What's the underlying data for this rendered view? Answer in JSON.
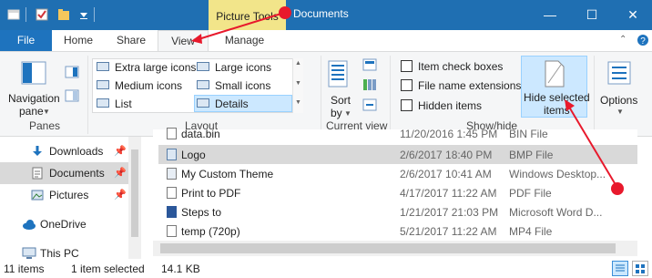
{
  "titlebar": {
    "contextual_tab": "Picture Tools",
    "window_title": "Documents",
    "minimize": "—",
    "maximize": "☐",
    "close": "✕"
  },
  "tabs": {
    "file": "File",
    "home": "Home",
    "share": "Share",
    "view": "View",
    "manage": "Manage"
  },
  "ribbon": {
    "panes": {
      "navigation_pane_line1": "Navigation",
      "navigation_pane_line2": "pane",
      "group": "Panes"
    },
    "layout": {
      "items": [
        "Extra large icons",
        "Large icons",
        "Medium icons",
        "Small icons",
        "List",
        "Details"
      ],
      "selected": "Details",
      "group": "Layout"
    },
    "current_view": {
      "sort_line1": "Sort",
      "sort_line2": "by",
      "group": "Current view"
    },
    "show_hide": {
      "item_check_boxes": "Item check boxes",
      "file_name_extensions": "File name extensions",
      "hidden_items": "Hidden items",
      "hide_selected_line1": "Hide selected",
      "hide_selected_line2": "items",
      "group": "Show/hide"
    },
    "options": "Options"
  },
  "nav": {
    "items": [
      {
        "label": "Downloads",
        "icon": "download-icon"
      },
      {
        "label": "Documents",
        "icon": "documents-icon"
      },
      {
        "label": "Pictures",
        "icon": "pictures-icon"
      },
      {
        "label": "OneDrive",
        "icon": "cloud-icon"
      },
      {
        "label": "This PC",
        "icon": "computer-icon"
      }
    ]
  },
  "files": [
    {
      "name": "data.bin",
      "date": "11/20/2016 1:45 PM",
      "type": "BIN File"
    },
    {
      "name": "Logo",
      "date": "2/6/2017 18:40 PM",
      "type": "BMP File"
    },
    {
      "name": "My Custom Theme",
      "date": "2/6/2017 10:41 AM",
      "type": "Windows Desktop..."
    },
    {
      "name": "Print to PDF",
      "date": "4/17/2017 11:22 AM",
      "type": "PDF File"
    },
    {
      "name": "Steps to",
      "date": "1/21/2017 21:03 PM",
      "type": "Microsoft Word D..."
    },
    {
      "name": "temp (720p)",
      "date": "5/21/2017 11:22 AM",
      "type": "MP4 File"
    }
  ],
  "status": {
    "count": "11 items",
    "selection": "1 item selected",
    "size": "14.1 KB"
  },
  "colors": {
    "titlebar": "#1f6fb2",
    "picture_tools": "#f2e58a",
    "selection": "#cce8ff",
    "annotation": "#e8192c"
  }
}
